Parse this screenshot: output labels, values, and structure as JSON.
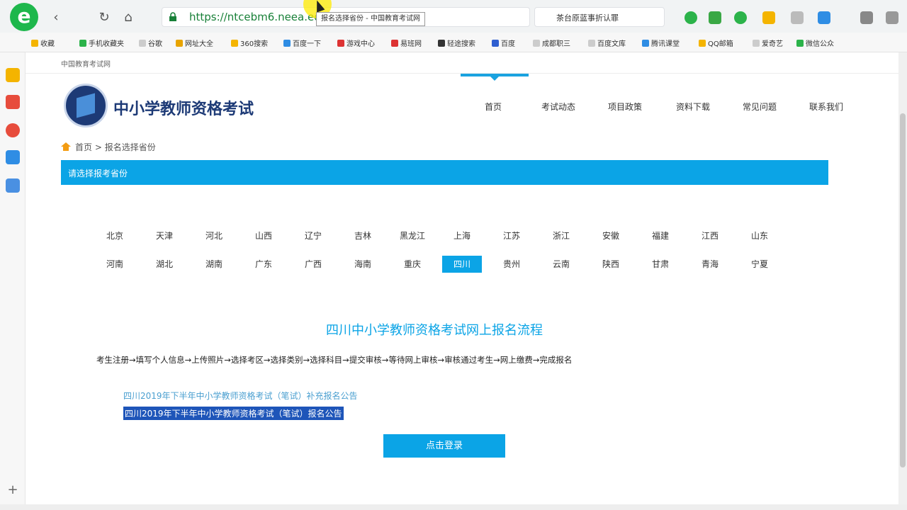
{
  "browser": {
    "url": "https://ntcebm6.neea.edu.",
    "tooltip": "报名选择省份 - 中国教育考试网",
    "search_text": "茶台原蓝事折认罪"
  },
  "bookmarks": [
    "收藏",
    "手机收藏夹",
    "谷歌",
    "网址大全",
    "360搜索",
    "百度一下",
    "游戏中心",
    "易班网",
    "轻途搜索",
    "百度",
    "成都职三",
    "百度文库",
    "腾讯课堂",
    "QQ邮箱",
    "爱奇艺",
    "微信公众"
  ],
  "page": {
    "top_link": "中国教育考试网",
    "site_title": "中小学教师资格考试",
    "nav": [
      "首页",
      "考试动态",
      "项目政策",
      "资料下载",
      "常见问题",
      "联系我们"
    ],
    "breadcrumb": {
      "home": "首页",
      "sep": ">",
      "current": "报名选择省份"
    },
    "banner": "请选择报考省份",
    "provinces_row1": [
      "北京",
      "天津",
      "河北",
      "山西",
      "辽宁",
      "吉林",
      "黑龙江",
      "上海",
      "江苏",
      "浙江",
      "安徽",
      "福建",
      "江西",
      "山东"
    ],
    "provinces_row2": [
      "河南",
      "湖北",
      "湖南",
      "广东",
      "广西",
      "海南",
      "重庆",
      "四川",
      "贵州",
      "云南",
      "陕西",
      "甘肃",
      "青海",
      "宁夏"
    ],
    "selected_province": "四川",
    "flow_title": "四川中小学教师资格考试网上报名流程",
    "flow_steps": "考生注册→填写个人信息→上传照片→选择考区→选择类别→选择科目→提交审核→等待网上审核→审核通过考生→网上缴费→完成报名",
    "notices": [
      "四川2019年下半年中小学教师资格考试（笔试）补充报名公告",
      "四川2019年下半年中小学教师资格考试（笔试）报名公告"
    ],
    "login_button": "点击登录"
  }
}
